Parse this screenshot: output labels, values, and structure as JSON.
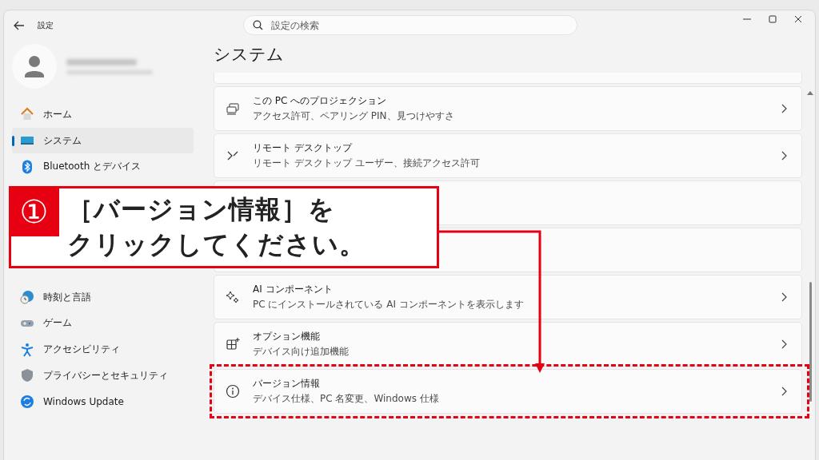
{
  "window": {
    "title": "設定"
  },
  "search": {
    "placeholder": "設定の検索"
  },
  "sidebar": {
    "items": [
      {
        "kind": "item",
        "label": "ホーム",
        "selected": false
      },
      {
        "kind": "item",
        "label": "システム",
        "selected": true
      },
      {
        "kind": "item",
        "label": "Bluetooth とデバイス",
        "selected": false
      },
      {
        "kind": "covered"
      },
      {
        "kind": "covered"
      },
      {
        "kind": "covered"
      },
      {
        "kind": "covered"
      },
      {
        "kind": "item",
        "label": "時刻と言語",
        "selected": false
      },
      {
        "kind": "item",
        "label": "ゲーム",
        "selected": false
      },
      {
        "kind": "item",
        "label": "アクセシビリティ",
        "selected": false
      },
      {
        "kind": "item",
        "label": "プライバシーとセキュリティ",
        "selected": false
      },
      {
        "kind": "item",
        "label": "Windows Update",
        "selected": false
      }
    ]
  },
  "page_title": "システム",
  "cards": [
    {
      "kind": "clipped"
    },
    {
      "kind": "item",
      "title": "この PC へのプロジェクション",
      "subtitle": "アクセス許可、ペアリング PIN、見つけやすさ",
      "highlighted": false
    },
    {
      "kind": "item",
      "title": "リモート デスクトップ",
      "subtitle": "リモート デスクトップ ユーザー、接続アクセス許可",
      "highlighted": false
    },
    {
      "kind": "covered"
    },
    {
      "kind": "covered"
    },
    {
      "kind": "item",
      "title": "AI コンポーネント",
      "subtitle": "PC にインストールされている AI コンポーネントを表示します",
      "highlighted": false
    },
    {
      "kind": "item",
      "title": "オプション機能",
      "subtitle": "デバイス向け追加機能",
      "highlighted": false
    },
    {
      "kind": "item",
      "title": "バージョン情報",
      "subtitle": "デバイス仕様、PC 名変更、Windows 仕様",
      "highlighted": true
    }
  ],
  "callout": {
    "number": "①",
    "lines": [
      "［バージョン情報］を",
      "クリックしてください。"
    ]
  }
}
